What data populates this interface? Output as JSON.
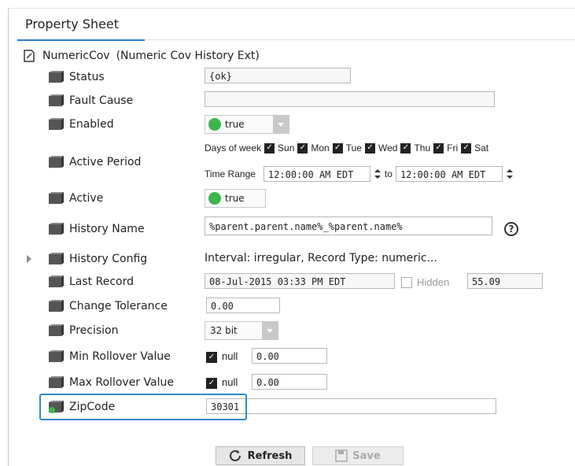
{
  "tab": {
    "label": "Property Sheet"
  },
  "root": {
    "name": "NumericCov",
    "type": "(Numeric Cov History Ext)"
  },
  "props": {
    "status": {
      "name": "Status",
      "value": "{ok}"
    },
    "fault_cause": {
      "name": "Fault Cause",
      "value": ""
    },
    "enabled": {
      "name": "Enabled",
      "value": "true"
    },
    "active_period": {
      "name": "Active Period",
      "days_label": "Days of week",
      "days": [
        "Sun",
        "Mon",
        "Tue",
        "Wed",
        "Thu",
        "Fri",
        "Sat"
      ],
      "time_range_label": "Time Range",
      "start": "12:00:00 AM EDT",
      "to": "to",
      "end": "12:00:00 AM EDT"
    },
    "active": {
      "name": "Active",
      "value": "true"
    },
    "history_name": {
      "name": "History Name",
      "value": "%parent.parent.name%_%parent.name%"
    },
    "history_config": {
      "name": "History Config",
      "value": "Interval: irregular, Record Type: numeric..."
    },
    "last_record": {
      "name": "Last Record",
      "timestamp": "08-Jul-2015 03:33 PM EDT",
      "hidden_label": "Hidden",
      "value": "55.09"
    },
    "change_tolerance": {
      "name": "Change Tolerance",
      "value": "0.00"
    },
    "precision": {
      "name": "Precision",
      "value": "32 bit"
    },
    "min_rollover": {
      "name": "Min Rollover Value",
      "null_label": "null",
      "value": "0.00"
    },
    "max_rollover": {
      "name": "Max Rollover Value",
      "null_label": "null",
      "value": "0.00"
    },
    "zipcode": {
      "name": "ZipCode",
      "value": "30301"
    }
  },
  "buttons": {
    "refresh": "Refresh",
    "save": "Save"
  },
  "colors": {
    "accent": "#2b7bd1",
    "highlight": "#2f8ac7",
    "status_green": "#3cb54a"
  }
}
